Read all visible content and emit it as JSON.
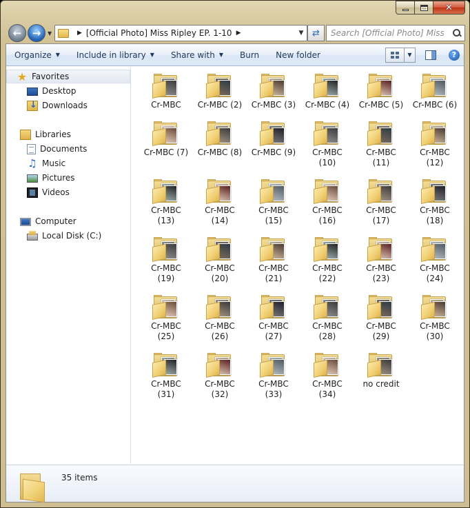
{
  "window": {
    "controls": {
      "minimize": "minimize",
      "maximize": "maximize",
      "close": "✕"
    }
  },
  "address": {
    "path": "[Official Photo] Miss Ripley EP. 1-10",
    "search_placeholder": "Search [Official Photo] Miss Rip..."
  },
  "toolbar": {
    "organize": "Organize",
    "include": "Include in library",
    "share": "Share with",
    "burn": "Burn",
    "new_folder": "New folder"
  },
  "nav": {
    "favorites": "Favorites",
    "desktop": "Desktop",
    "downloads": "Downloads",
    "libraries": "Libraries",
    "documents": "Documents",
    "music": "Music",
    "pictures": "Pictures",
    "videos": "Videos",
    "computer": "Computer",
    "local_disk": "Local Disk (C:)"
  },
  "folders": [
    {
      "label": "Cr-MBC"
    },
    {
      "label": "Cr-MBC (2)"
    },
    {
      "label": "Cr-MBC (3)"
    },
    {
      "label": "Cr-MBC (4)"
    },
    {
      "label": "Cr-MBC (5)"
    },
    {
      "label": "Cr-MBC (6)"
    },
    {
      "label": "Cr-MBC (7)"
    },
    {
      "label": "Cr-MBC (8)"
    },
    {
      "label": "Cr-MBC (9)"
    },
    {
      "label": "Cr-MBC (10)"
    },
    {
      "label": "Cr-MBC (11)"
    },
    {
      "label": "Cr-MBC (12)"
    },
    {
      "label": "Cr-MBC (13)"
    },
    {
      "label": "Cr-MBC (14)"
    },
    {
      "label": "Cr-MBC (15)"
    },
    {
      "label": "Cr-MBC (16)"
    },
    {
      "label": "Cr-MBC (17)"
    },
    {
      "label": "Cr-MBC (18)"
    },
    {
      "label": "Cr-MBC (19)"
    },
    {
      "label": "Cr-MBC (20)"
    },
    {
      "label": "Cr-MBC (21)"
    },
    {
      "label": "Cr-MBC (22)"
    },
    {
      "label": "Cr-MBC (23)"
    },
    {
      "label": "Cr-MBC (24)"
    },
    {
      "label": "Cr-MBC (25)"
    },
    {
      "label": "Cr-MBC (26)"
    },
    {
      "label": "Cr-MBC (27)"
    },
    {
      "label": "Cr-MBC (28)"
    },
    {
      "label": "Cr-MBC (29)"
    },
    {
      "label": "Cr-MBC (30)"
    },
    {
      "label": "Cr-MBC (31)"
    },
    {
      "label": "Cr-MBC (32)"
    },
    {
      "label": "Cr-MBC (33)"
    },
    {
      "label": "Cr-MBC (34)"
    },
    {
      "label": "no credit"
    }
  ],
  "status": {
    "count": "35 items"
  },
  "colors": {
    "accent": "#1e395b",
    "folder": "#f0cf73",
    "nav_highlight": "#e2e9f2"
  }
}
